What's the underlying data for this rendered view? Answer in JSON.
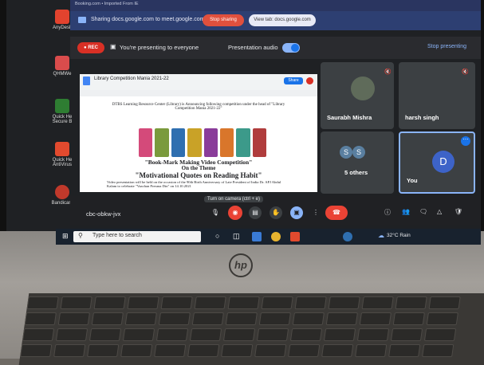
{
  "browser": {
    "tab_hint": "Booking.com  •  Imported From IE",
    "share_text": "Sharing docs.google.com to meet.google.com",
    "stop_sharing_label": "Stop sharing",
    "view_tab_label": "View tab: docs.google.com"
  },
  "meet": {
    "rec_label": "REC",
    "presenting_label": "You're presenting to everyone",
    "audio_label": "Presentation audio",
    "stop_presenting_label": "Stop presenting",
    "meeting_code": "cbc-obkw-jvx",
    "camera_tooltip": "Turn on camera (ctrl + e)",
    "participants": [
      {
        "name": "Saurabh Mishra"
      },
      {
        "name": "harsh singh"
      },
      {
        "name": "5 others",
        "initials": [
          "S",
          "S"
        ]
      },
      {
        "name": "You",
        "initial": "D"
      }
    ]
  },
  "doc": {
    "title": "Library Competition Mania 2021-22",
    "share_label": "Share",
    "intro": "DTBS Learning Resource Center (Library) is Announcing following competition under the head of \"Library Competition Mania 2021-22\"",
    "heading1": "\"Book-Mark Making Video Competition\"",
    "heading2": "On the Theme",
    "heading3": "\"Motivational Quotes on Reading Habit\"",
    "body": "Video presentation will be held on the occasion of the 90th Birth Anniversary of Late President of India Dr. APJ Abdul Kalam to celebrate \"Vaachan Prerana Din\" on 14.10.2021",
    "bookmark_colors": [
      "#d44a7a",
      "#7a9a3c",
      "#2f6fb0",
      "#c9a227",
      "#8a3c9a",
      "#d9762b",
      "#3c9a8a",
      "#b03c3c"
    ]
  },
  "desktop": {
    "icons": [
      {
        "label": "AnyDesk",
        "color": "#e2432e"
      },
      {
        "label": "QHMWe",
        "color": "#d94c4c"
      },
      {
        "label": "Quick He Secure B",
        "color": "#2e7d32"
      },
      {
        "label": "Quick He AntiVirus",
        "color": "#e24a2e"
      },
      {
        "label": "Bandicam",
        "color": "#c0392b"
      }
    ]
  },
  "taskbar": {
    "search_placeholder": "Type here to search",
    "weather": "32°C  Rain"
  },
  "laptop": {
    "brand": "hp"
  }
}
